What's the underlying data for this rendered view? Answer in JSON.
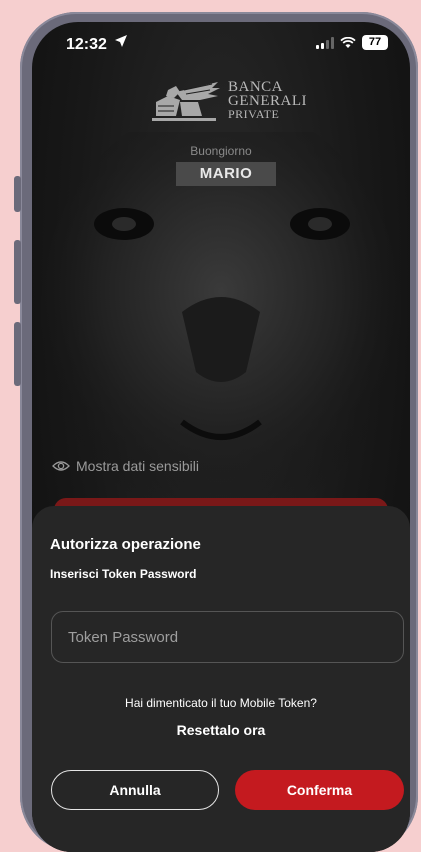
{
  "status_bar": {
    "time": "12:32",
    "battery": "77",
    "location_icon": "location-arrow-icon",
    "signal_icon": "cellular-signal-icon",
    "wifi_icon": "wifi-icon"
  },
  "brand": {
    "line1": "BANCA",
    "line2": "GENERALI",
    "line3": "PRIVATE",
    "logo_icon": "winged-lion-logo"
  },
  "greeting": "Buongiorno",
  "user_name": "MARIO",
  "show_sensitive": {
    "label": "Mostra dati sensibili",
    "icon": "eye-icon"
  },
  "sheet": {
    "title": "Autorizza operazione",
    "subtitle": "Inserisci Token Password",
    "token_placeholder": "Token Password",
    "token_value": "",
    "forgot_text": "Hai dimenticato il tuo Mobile Token?",
    "reset_link": "Resettalo ora",
    "cancel_label": "Annulla",
    "confirm_label": "Conferma"
  },
  "colors": {
    "accent": "#c41a1f",
    "sheet_bg": "#262626",
    "page_bg": "#f6cfcf"
  }
}
